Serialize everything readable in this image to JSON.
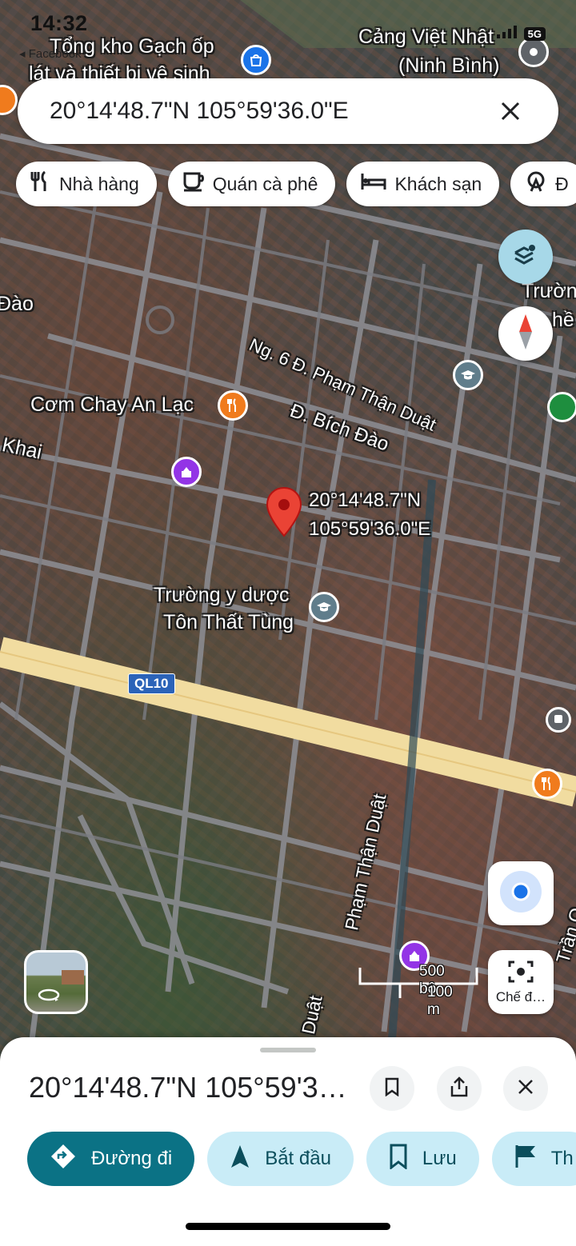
{
  "status_bar": {
    "time": "14:32",
    "back_app": "Facebook",
    "network": "5G"
  },
  "search": {
    "query": "20°14'48.7\"N 105°59'36.0\"E"
  },
  "chips": [
    {
      "label": "Nhà hàng",
      "icon": "fork-knife-icon"
    },
    {
      "label": "Quán cà phê",
      "icon": "coffee-cup-icon"
    },
    {
      "label": "Khách sạn",
      "icon": "bed-icon"
    },
    {
      "label": "Đ",
      "icon": "attraction-icon"
    }
  ],
  "map": {
    "labels": {
      "warehouse_line1": "Tổng kho Gạch ốp",
      "warehouse_line2": "lát và thiết bị vệ sinh",
      "port_line1": "Cảng Việt Nhật",
      "port_line2": "(Ninh Bình)",
      "school_right": "Trườn",
      "school_right2": "hề",
      "dao_left": "Đào",
      "street_lane6": "Ng. 6 Đ. Phạm Thận Duật",
      "street_bichdao": "Đ. Bích Đào",
      "restaurant_name": "Cơm Chay An Lạc",
      "street_khai": "Khai",
      "pin_coord_line1": "20°14'48.7\"N",
      "pin_coord_line2": "105°59'36.0\"E",
      "medical_school_line1": "Trường y dược",
      "medical_school_line2": "Tôn Thất Tùng",
      "highway_shield": "QL10",
      "street_pham_than_duat": "Phạm Thận Duật",
      "street_duat_bottom": "Duật",
      "street_tran": "Trần Q"
    },
    "scale": {
      "imperial": "500 bộ",
      "metric": "100 m"
    },
    "lens_label": "Chế đ…"
  },
  "sheet": {
    "title": "20°14'48.7\"N 105°59'3…",
    "actions": [
      {
        "label": "Đường đi",
        "icon": "directions-icon"
      },
      {
        "label": "Bắt đầu",
        "icon": "navigation-arrow-icon"
      },
      {
        "label": "Lưu",
        "icon": "bookmark-icon"
      },
      {
        "label": "Th",
        "icon": "flag-icon"
      }
    ]
  },
  "colors": {
    "accent": "#0b7285",
    "chip_tint": "#c9ecf7",
    "pin_red": "#ea4335",
    "road_yellow": "#f1dca0"
  }
}
